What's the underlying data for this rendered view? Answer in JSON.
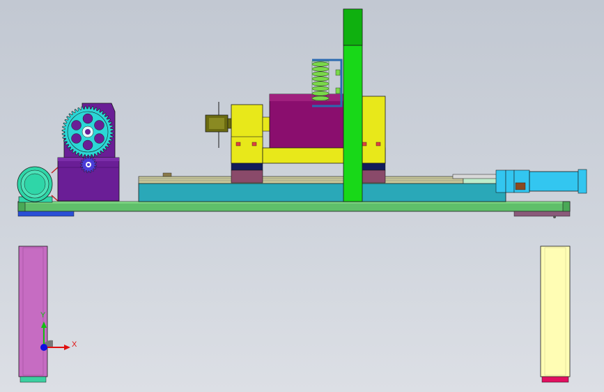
{
  "viewport": {
    "axis_x_label": "X",
    "axis_y_label": "Y",
    "axis_x_color": "#e01010",
    "axis_y_color": "#10c010",
    "axis_z_color": "#1010e0",
    "background_top": "#c2c8d2",
    "background_bottom": "#dcdfe5"
  },
  "model": {
    "colors": {
      "base_plate": "#5fbf6a",
      "slide_base": "#2aa8b8",
      "gear_housing": "#6a1e96",
      "gear": "#2cd6d6",
      "pinion": "#4b3cd8",
      "motor": "#2fd6a8",
      "spindle_body": "#8a0e6e",
      "bearing_blocks": "#e8e81a",
      "chuck": "#6a6a10",
      "column": "#18d818",
      "spring_coil": "#7ad84a",
      "cylinder": "#33c6f0",
      "leg_left": "#c66cc2",
      "leg_right": "#fffdb4"
    }
  }
}
